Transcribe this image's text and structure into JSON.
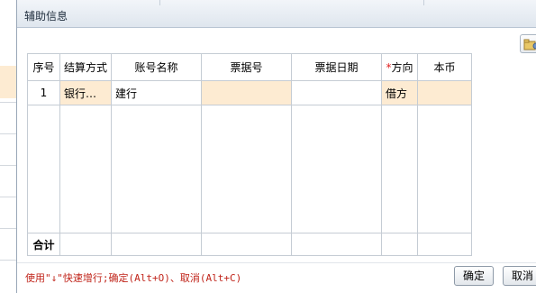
{
  "dialog": {
    "title": "辅助信息",
    "hint": "使用\"↓\"快速增行;确定(Alt+O)、取消(Alt+C)",
    "ok_label": "确定",
    "cancel_label": "取消"
  },
  "grid": {
    "columns": [
      "序号",
      "结算方式",
      "账号名称",
      "票据号",
      "票据日期",
      "方向",
      "本币"
    ],
    "required_marker": "*",
    "rows": [
      {
        "seq": "1",
        "settle": "银行…",
        "account": "建行",
        "bill_no": "",
        "bill_date": "",
        "direction": "借方",
        "amount": ""
      }
    ],
    "total_label": "合计"
  },
  "colors": {
    "row_highlight": "#fdebd2",
    "hint_text": "#c0241a",
    "required": "#e02020"
  }
}
